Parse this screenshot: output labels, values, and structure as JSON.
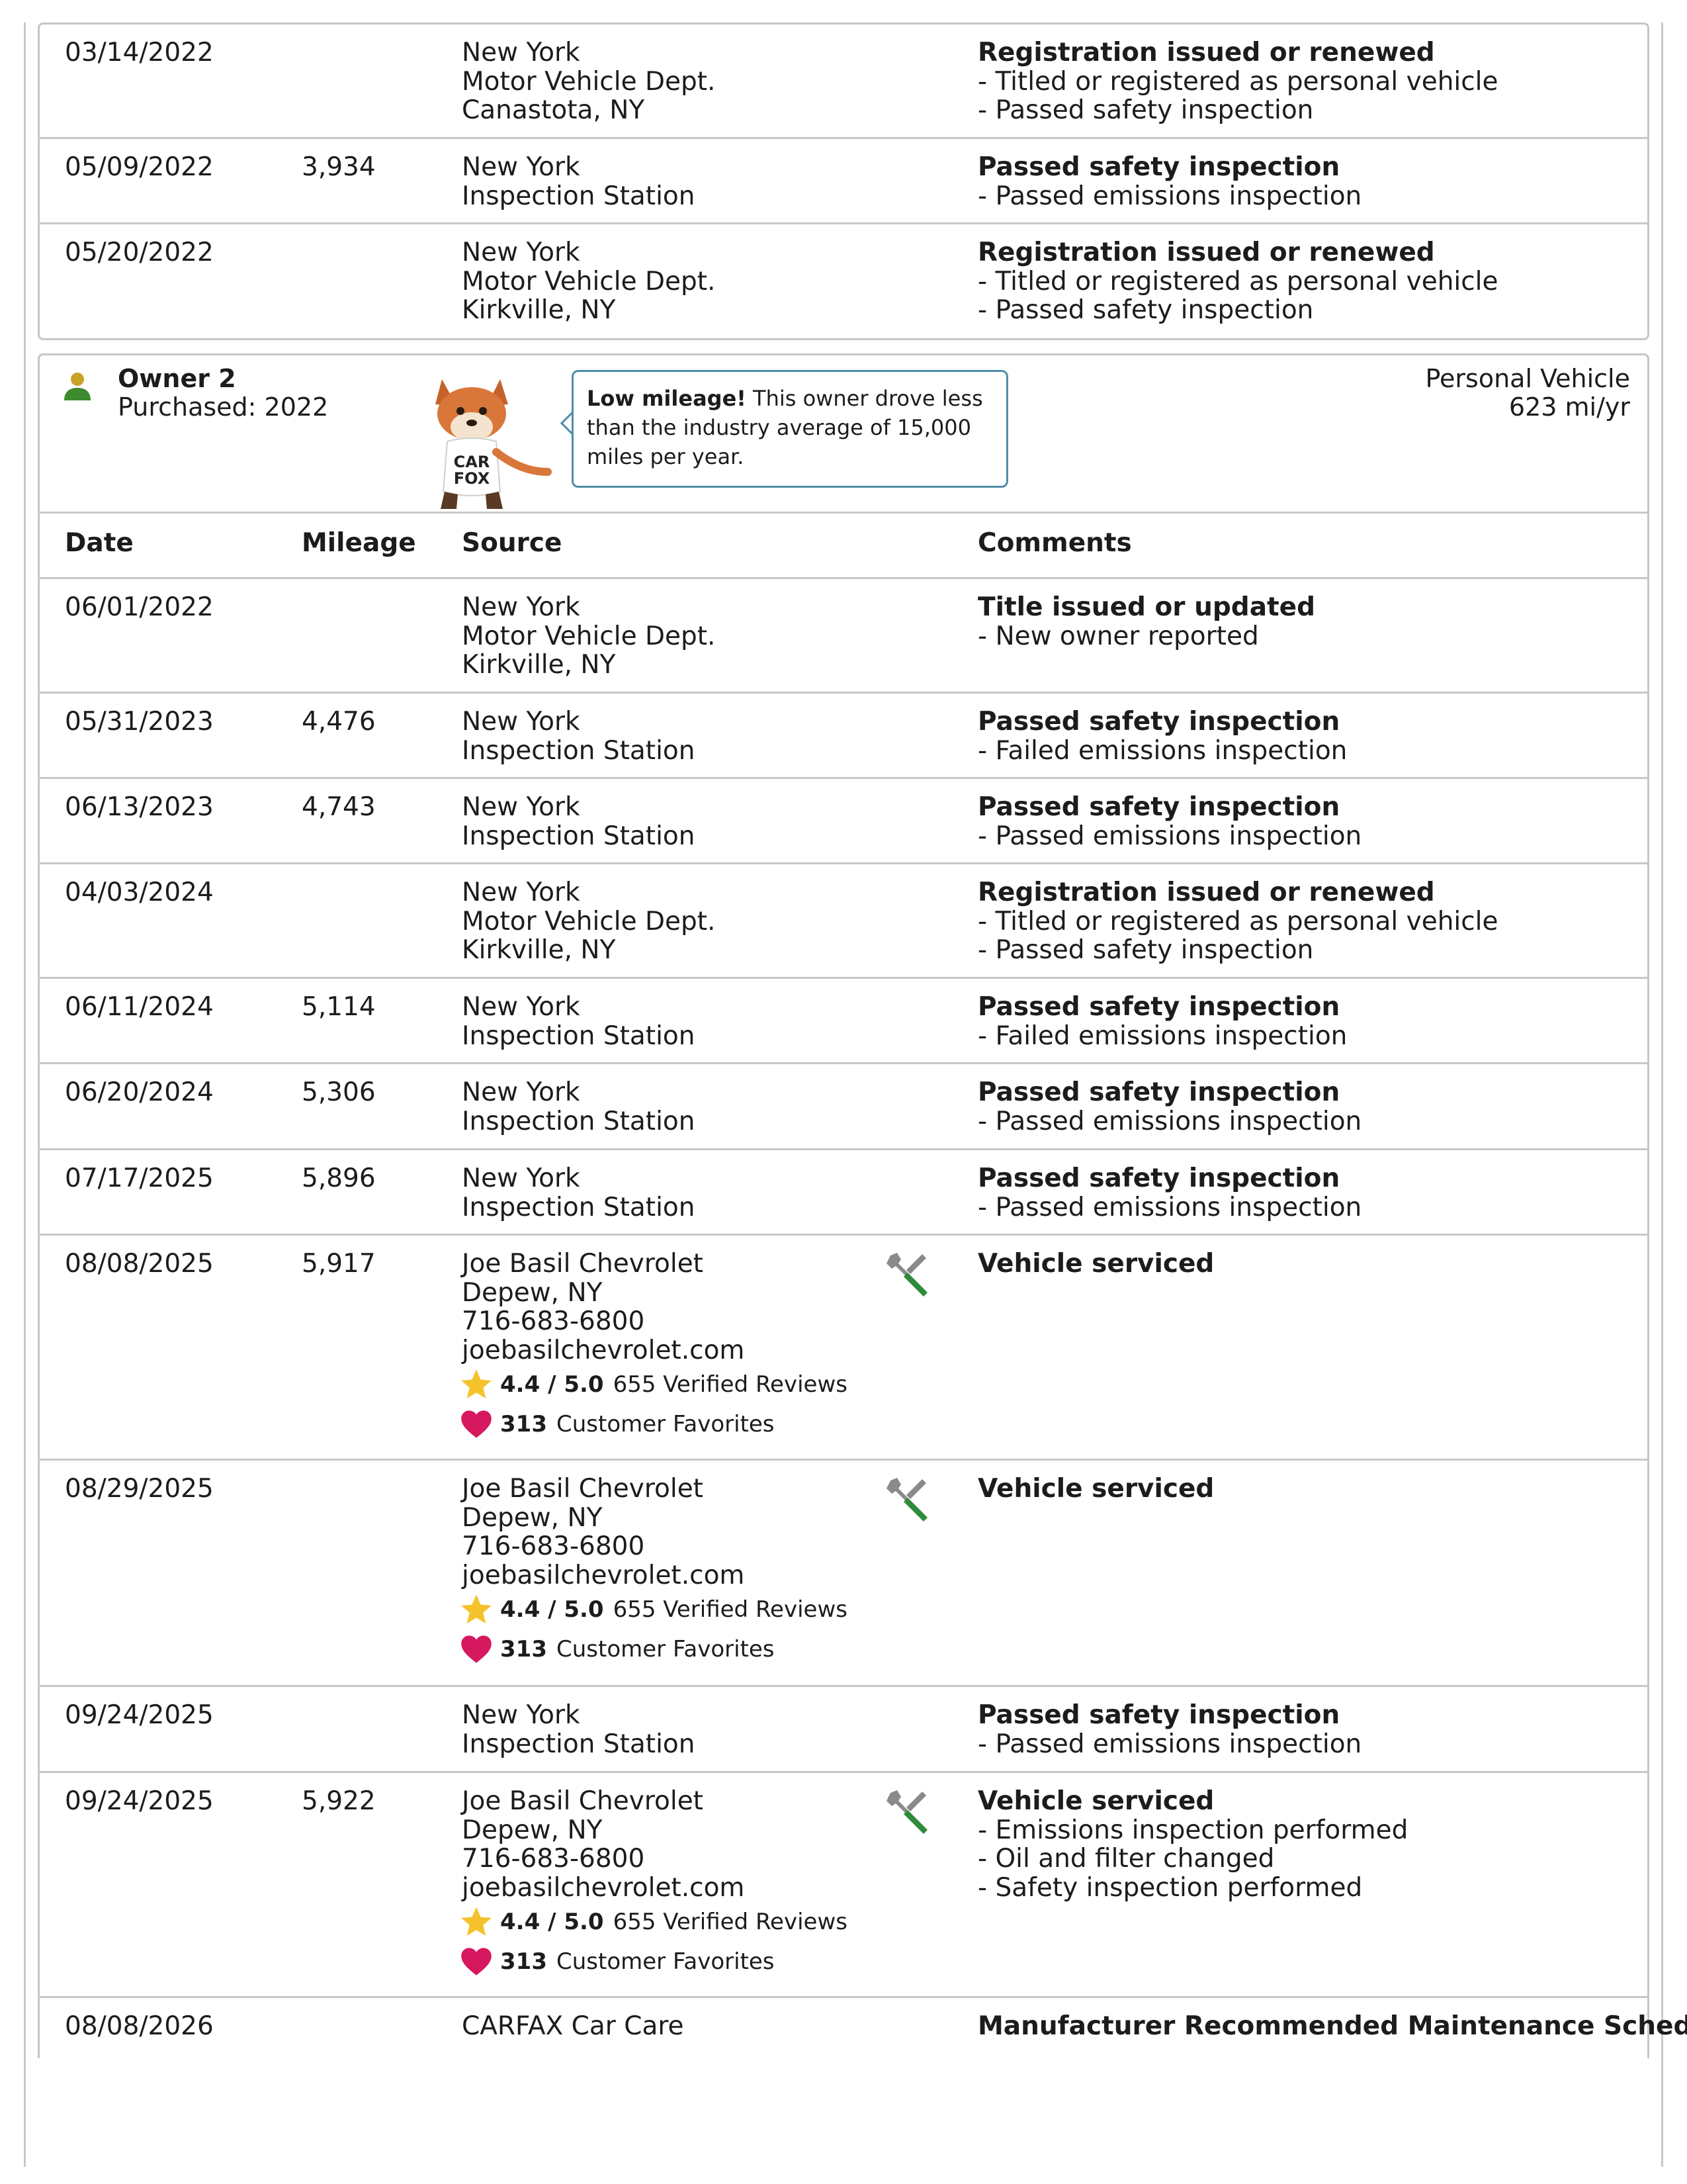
{
  "owner1_records": [
    {
      "date": "03/14/2022",
      "mileage": "",
      "source": [
        "New York",
        "Motor Vehicle Dept.",
        "Canastota, NY"
      ],
      "comment_title": "Registration issued or renewed",
      "comments": [
        "- Titled or registered as personal vehicle",
        "- Passed safety inspection"
      ]
    },
    {
      "date": "05/09/2022",
      "mileage": "3,934",
      "source": [
        "New York",
        "Inspection Station"
      ],
      "comment_title": "Passed safety inspection",
      "comments": [
        "- Passed emissions inspection"
      ]
    },
    {
      "date": "05/20/2022",
      "mileage": "",
      "source": [
        "New York",
        "Motor Vehicle Dept.",
        "Kirkville, NY"
      ],
      "comment_title": "Registration issued or renewed",
      "comments": [
        "- Titled or registered as personal vehicle",
        "- Passed safety inspection"
      ]
    }
  ],
  "owner2": {
    "title": "Owner 2",
    "purchased": "Purchased: 2022",
    "fox_badge": [
      "CAR",
      "FOX"
    ],
    "bubble_bold": "Low mileage!",
    "bubble_text_1": " This owner drove less",
    "bubble_text_2": "than the industry average of 15,000",
    "bubble_text_3": "miles per year.",
    "vehicle_type": "Personal Vehicle",
    "rate": "623 mi/yr"
  },
  "table_headers": {
    "date": "Date",
    "mileage": "Mileage",
    "source": "Source",
    "comments": "Comments"
  },
  "dealer": {
    "rating": "4.4 / 5.0",
    "reviews": "655 Verified Reviews",
    "favorites_count": "313",
    "favorites_label": "Customer Favorites"
  },
  "owner2_records": [
    {
      "date": "06/01/2022",
      "mileage": "",
      "source": [
        "New York",
        "Motor Vehicle Dept.",
        "Kirkville, NY"
      ],
      "comment_title": "Title issued or updated",
      "comments": [
        "- New owner reported"
      ]
    },
    {
      "date": "05/31/2023",
      "mileage": "4,476",
      "source": [
        "New York",
        "Inspection Station"
      ],
      "comment_title": "Passed safety inspection",
      "comments": [
        "- Failed emissions inspection"
      ]
    },
    {
      "date": "06/13/2023",
      "mileage": "4,743",
      "source": [
        "New York",
        "Inspection Station"
      ],
      "comment_title": "Passed safety inspection",
      "comments": [
        "- Passed emissions inspection"
      ]
    },
    {
      "date": "04/03/2024",
      "mileage": "",
      "source": [
        "New York",
        "Motor Vehicle Dept.",
        "Kirkville, NY"
      ],
      "comment_title": "Registration issued or renewed",
      "comments": [
        "- Titled or registered as personal vehicle",
        "- Passed safety inspection"
      ]
    },
    {
      "date": "06/11/2024",
      "mileage": "5,114",
      "source": [
        "New York",
        "Inspection Station"
      ],
      "comment_title": "Passed safety inspection",
      "comments": [
        "- Failed emissions inspection"
      ]
    },
    {
      "date": "06/20/2024",
      "mileage": "5,306",
      "source": [
        "New York",
        "Inspection Station"
      ],
      "comment_title": "Passed safety inspection",
      "comments": [
        "- Passed emissions inspection"
      ]
    },
    {
      "date": "07/17/2025",
      "mileage": "5,896",
      "source": [
        "New York",
        "Inspection Station"
      ],
      "comment_title": "Passed safety inspection",
      "comments": [
        "- Passed emissions inspection"
      ]
    },
    {
      "date": "08/08/2025",
      "mileage": "5,917",
      "source": [
        "Joe Basil Chevrolet",
        "Depew, NY",
        "716-683-6800",
        "joebasilchevrolet.com"
      ],
      "comment_title": "Vehicle serviced",
      "comments": []
    },
    {
      "date": "08/29/2025",
      "mileage": "",
      "source": [
        "Joe Basil Chevrolet",
        "Depew, NY",
        "716-683-6800",
        "joebasilchevrolet.com"
      ],
      "comment_title": "Vehicle serviced",
      "comments": []
    },
    {
      "date": "09/24/2025",
      "mileage": "",
      "source": [
        "New York",
        "Inspection Station"
      ],
      "comment_title": "Passed safety inspection",
      "comments": [
        "- Passed emissions inspection"
      ]
    },
    {
      "date": "09/24/2025",
      "mileage": "5,922",
      "source": [
        "Joe Basil Chevrolet",
        "Depew, NY",
        "716-683-6800",
        "joebasilchevrolet.com"
      ],
      "comment_title": "Vehicle serviced",
      "comments": [
        "- Emissions inspection performed",
        "- Oil and filter changed",
        "- Safety inspection performed"
      ]
    },
    {
      "date": "08/08/2026",
      "mileage": "",
      "source": [
        "CARFAX Car Care"
      ],
      "comment_title": "Manufacturer Recommended Maintenance Schedules",
      "comments": []
    }
  ],
  "colors": {
    "border": "#c8c8c8",
    "bubble_border": "#4f8ea8",
    "star": "#f4c22b",
    "heart": "#d6185f",
    "wrench_green": "#2e8b3a",
    "wrench_gray": "#8a8a8a",
    "owner_icon": "#3d8b2e"
  }
}
